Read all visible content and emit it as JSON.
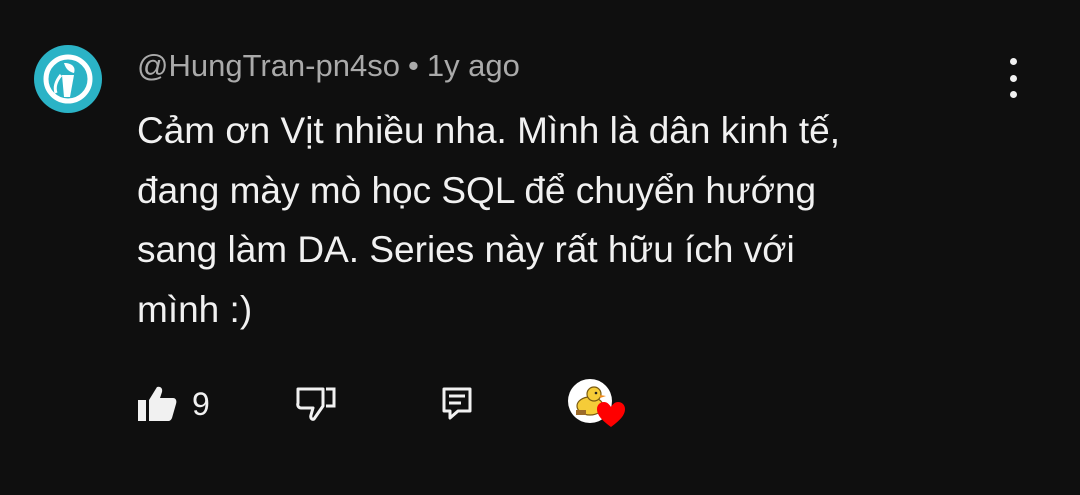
{
  "comment": {
    "author": "@HungTran-pn4so",
    "separator": "•",
    "time": "1y ago",
    "text_lines": [
      "Cảm ơn Vịt nhiều nha. Mình là dân kinh tế,",
      "đang mày mò học SQL để chuyển hướng",
      "sang làm DA. Series này rất hữu ích với",
      "mình :)"
    ]
  },
  "actions": {
    "like_count": "9",
    "like_icon": "thumbs-up-icon",
    "dislike_icon": "thumbs-down-icon",
    "reply_icon": "reply-comment-icon",
    "more_icon": "more-vertical-icon",
    "creator_heart_icon": "heart-icon"
  },
  "colors": {
    "background": "#0f0f0f",
    "avatar_bg": "#2bb3c6",
    "heart": "#ff0000",
    "meta_text": "#aaaaaa",
    "primary_text": "#f1f1f1"
  }
}
